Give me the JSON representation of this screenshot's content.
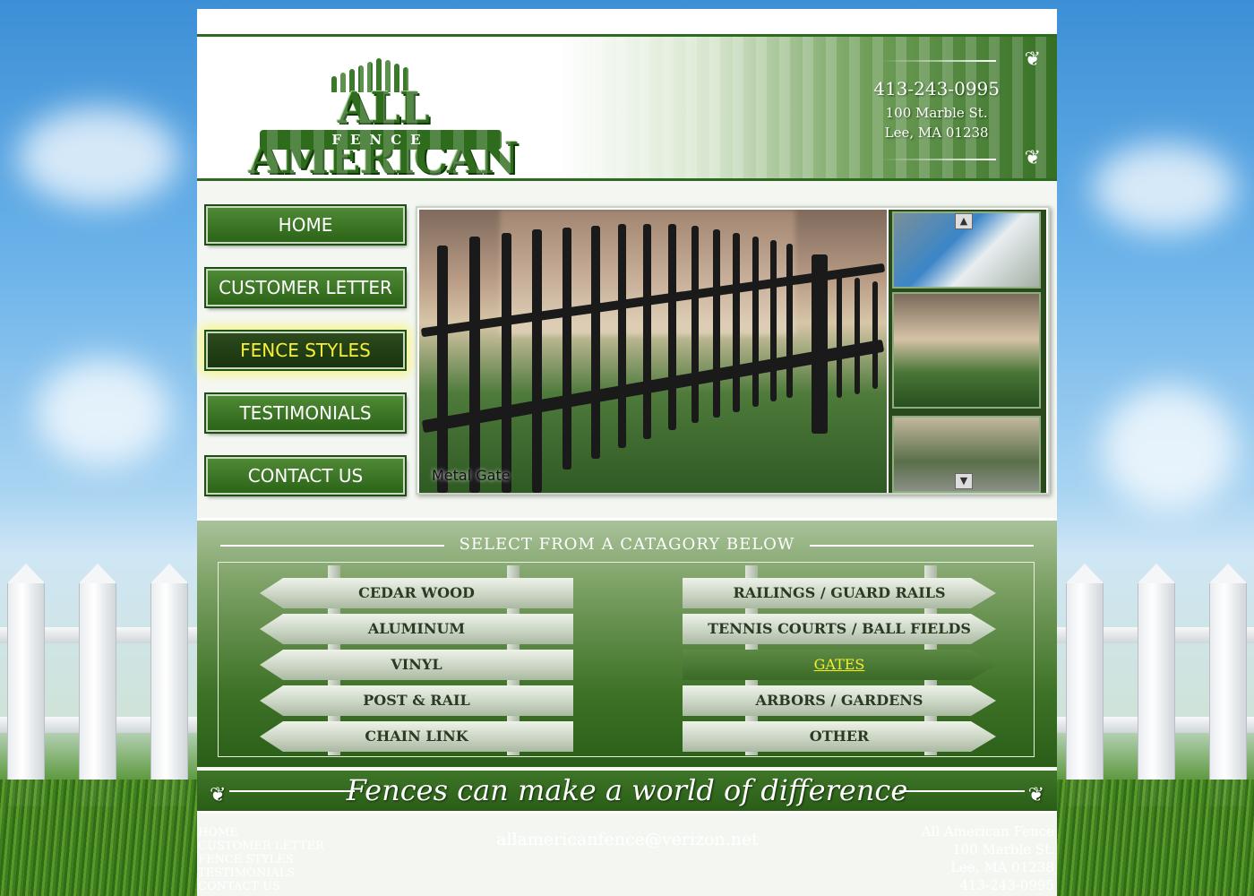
{
  "header": {
    "logo_title": "ALL AMERICAN",
    "logo_sub": "FENCE",
    "phone": "413-243-0995",
    "street": "100 Marble St.",
    "city": "Lee, MA 01238"
  },
  "nav": {
    "items": [
      {
        "label": "HOME"
      },
      {
        "label": "CUSTOMER LETTER"
      },
      {
        "label": "FENCE STYLES",
        "active": true
      },
      {
        "label": "TESTIMONIALS"
      },
      {
        "label": "CONTACT US"
      }
    ]
  },
  "gallery": {
    "caption": "Metal Gate",
    "scroll_up": "▲",
    "scroll_down": "▼"
  },
  "categories": {
    "heading": "SELECT FROM A CATAGORY BELOW",
    "left": [
      {
        "label": "CEDAR WOOD"
      },
      {
        "label": "ALUMINUM"
      },
      {
        "label": "VINYL"
      },
      {
        "label": "POST & RAIL"
      },
      {
        "label": "CHAIN LINK"
      }
    ],
    "right": [
      {
        "label": "RAILINGS / GUARD RAILS"
      },
      {
        "label": "TENNIS COURTS / BALL FIELDS"
      },
      {
        "label": "GATES",
        "active": true
      },
      {
        "label": "ARBORS / GARDENS"
      },
      {
        "label": "OTHER"
      }
    ]
  },
  "slogan": "Fences can make a world of difference",
  "footer": {
    "links": [
      "HOME",
      "CUSTOMER LETTER",
      "FENCE STYLES",
      "TESTIMONIALS",
      "CONTACT US"
    ],
    "email": "allamericanfence@verizon.net",
    "company": "All American Fence",
    "street": "100 Marble St.",
    "city": "Lee, MA 01238",
    "phone": "413-243-0995"
  },
  "colors": {
    "brand_green": "#2e6b1c",
    "active_text": "#f6ef3a"
  }
}
